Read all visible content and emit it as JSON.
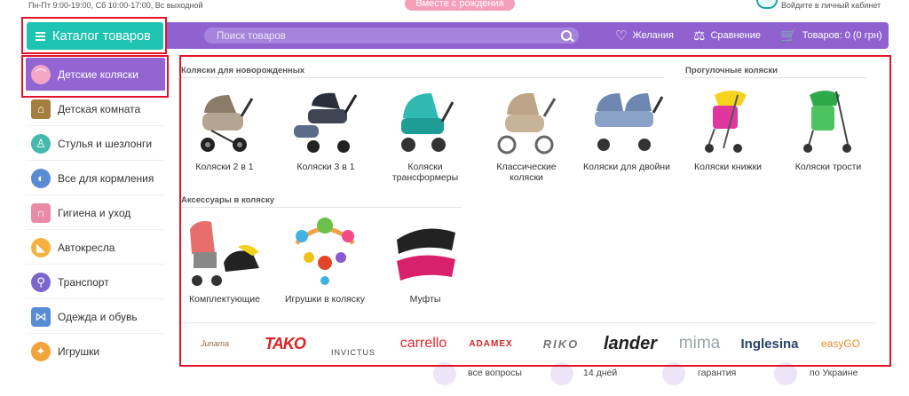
{
  "topbar": {
    "hours": "Пн-Пт 9:00-19:00, Сб 10:00-17:00, Вс выходной",
    "badge": "Вместе с рождения",
    "login": "Войдите в личный кабинет"
  },
  "header": {
    "catalog_label": "Каталог товаров",
    "search_placeholder": "Поиск товаров",
    "wishlist_label": "Желания",
    "compare_label": "Сравнение",
    "cart_label": "Товаров: 0 (0 грн)"
  },
  "colors": {
    "accent_purple": "#8f62cf",
    "catalog_teal": "#1ec3b1",
    "highlight_red": "#e3132c"
  },
  "sidebar": {
    "items": [
      {
        "label": "Детские коляски",
        "icon": "stroller-icon",
        "color": "#ef8fb2",
        "active": true
      },
      {
        "label": "Детская комната",
        "icon": "crib-icon",
        "color": "#a57e3f"
      },
      {
        "label": "Стулья и шезлонги",
        "icon": "high-chair-icon",
        "color": "#45b9ad"
      },
      {
        "label": "Все для кормления",
        "icon": "bottle-icon",
        "color": "#5a8cd6"
      },
      {
        "label": "Гигиена и уход",
        "icon": "diaper-icon",
        "color": "#e98aa6"
      },
      {
        "label": "Автокресла",
        "icon": "car-seat-icon",
        "color": "#f4b13f"
      },
      {
        "label": "Транспорт",
        "icon": "bicycle-icon",
        "color": "#7a66cc"
      },
      {
        "label": "Одежда и обувь",
        "icon": "bow-icon",
        "color": "#5a8cd6"
      },
      {
        "label": "Игрушки",
        "icon": "toy-icon",
        "color": "#f2a33a"
      }
    ]
  },
  "mega": {
    "newborn_title": "Коляски для новорожденных",
    "walking_title": "Прогулочные коляски",
    "accessories_title": "Аксессуары в коляску",
    "newborn_items": [
      {
        "label": "Коляски 2 в 1"
      },
      {
        "label": "Коляски 3 в 1"
      },
      {
        "label": "Коляски трансформеры"
      },
      {
        "label": "Классические коляски"
      },
      {
        "label": "Коляски для двойни"
      }
    ],
    "walking_items": [
      {
        "label": "Коляски книжки"
      },
      {
        "label": "Коляски трости"
      }
    ],
    "accessory_items": [
      {
        "label": "Комплектующие"
      },
      {
        "label": "Игрушки в коляску"
      },
      {
        "label": "Муфты"
      }
    ]
  },
  "brands": [
    {
      "name": "Junama",
      "color": "#8a6a4a"
    },
    {
      "name": "TAKO",
      "color": "#d82226"
    },
    {
      "name": "INVICTUS",
      "color": "#444444"
    },
    {
      "name": "carrello",
      "color": "#e3262b"
    },
    {
      "name": "ADAMEX",
      "color": "#d82226"
    },
    {
      "name": "RIKO",
      "color": "#777777"
    },
    {
      "name": "lander",
      "color": "#222222"
    },
    {
      "name": "mima",
      "color": "#9aa3a8"
    },
    {
      "name": "Inglesina",
      "color": "#27446e"
    },
    {
      "name": "easyGO",
      "color": "#f08c24"
    }
  ],
  "bottom": {
    "items": [
      "все вопросы",
      "14 дней",
      "гарантия",
      "по Украине"
    ]
  }
}
